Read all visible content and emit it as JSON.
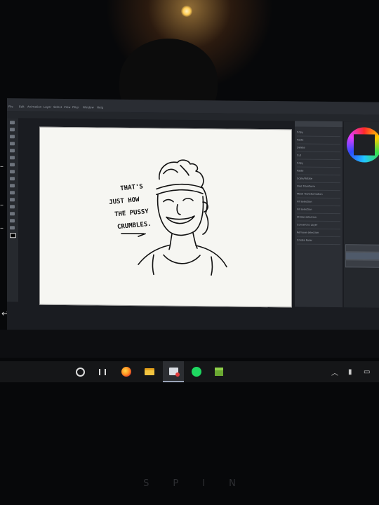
{
  "photo": {
    "subject": "laptop screen showing a drawing app with a sketch"
  },
  "app": {
    "menu": [
      "File",
      "Edit",
      "Animation",
      "Layer",
      "Select",
      "View",
      "Filter",
      "Window",
      "Help"
    ]
  },
  "drawing": {
    "caption_lines": [
      "THAT'S",
      "JUST HOW",
      "THE PUSSY",
      "CRUMBLES."
    ]
  },
  "panel": {
    "rows": [
      "Copy",
      "Paste",
      "Delete",
      "Cut",
      "Copy",
      "Paste",
      "Scale/Rotate",
      "Free Transform",
      "Mesh Transformation",
      "Fill selection",
      "Fill selection",
      "Stroke selection",
      "Convert to Layer",
      "Remove selection",
      "Create Ruler"
    ]
  },
  "bezel": {
    "brand": "SPIN"
  },
  "colors": {
    "accent_taskbar": "#9aa4b8",
    "screen_bg": "#1a1c21"
  }
}
